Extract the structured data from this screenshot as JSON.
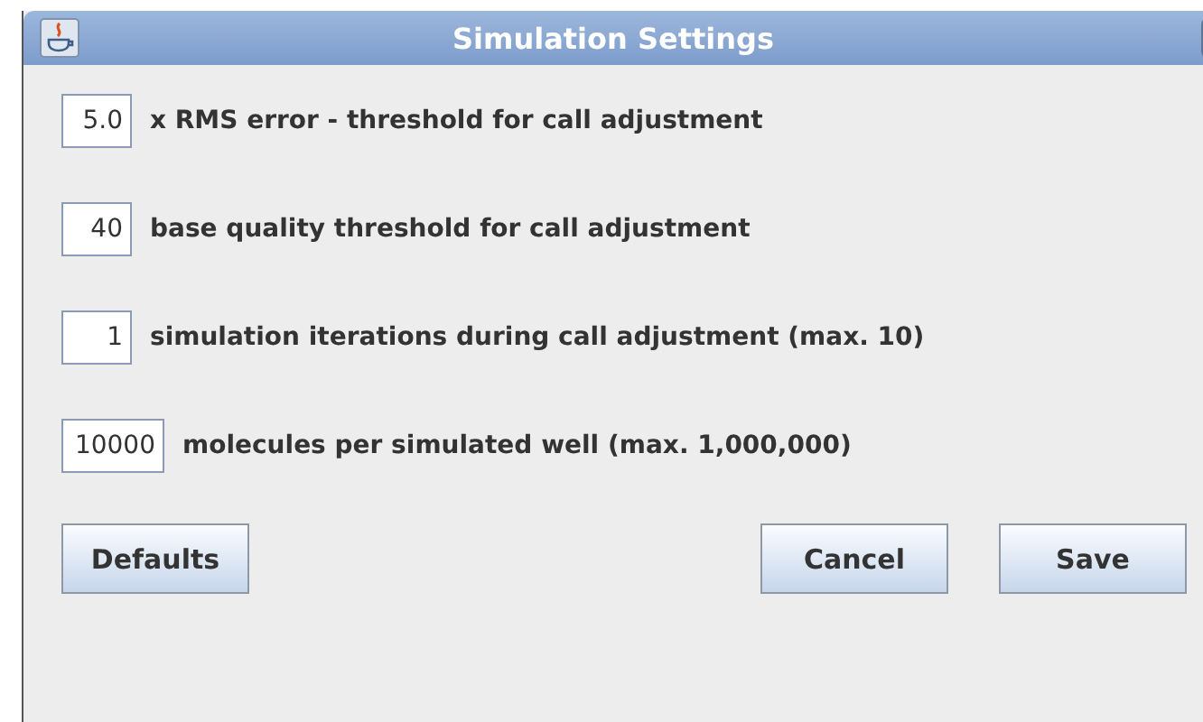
{
  "window": {
    "title": "Simulation Settings"
  },
  "settings": [
    {
      "value": "5.0",
      "label": "x RMS error - threshold for call adjustment"
    },
    {
      "value": "40",
      "label": "base quality threshold for call adjustment"
    },
    {
      "value": "1",
      "label": "simulation iterations during call adjustment (max. 10)"
    },
    {
      "value": "10000",
      "label": "molecules per simulated well (max. 1,000,000)"
    }
  ],
  "buttons": [
    {
      "label": "Defaults"
    },
    {
      "label": "Cancel"
    },
    {
      "label": "Save"
    }
  ]
}
